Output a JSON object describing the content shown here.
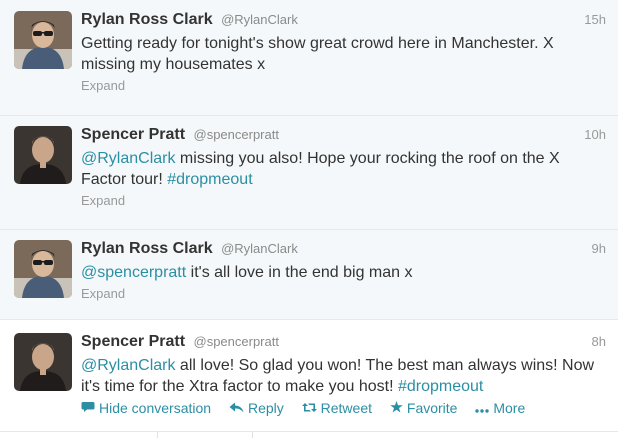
{
  "tweets": [
    {
      "fullname": "Rylan Ross Clark",
      "username": "@RylanClark",
      "time": "15h",
      "text": "Getting ready for tonight's show great crowd here in Manchester. X missing my housemates x",
      "expand": "Expand"
    },
    {
      "fullname": "Spencer Pratt",
      "username": "@spencerpratt",
      "time": "10h",
      "mention": "@RylanClark",
      "text": " missing you also! Hope your rocking the roof on the X Factor tour! ",
      "hashtag": "#dropmeout",
      "expand": "Expand"
    },
    {
      "fullname": "Rylan Ross Clark",
      "username": "@RylanClark",
      "time": "9h",
      "mention": "@spencerpratt",
      "text": " it's all love in the end big man x",
      "expand": "Expand"
    },
    {
      "fullname": "Spencer Pratt",
      "username": "@spencerpratt",
      "time": "8h",
      "mention": "@RylanClark",
      "text": " all love! So glad you won! The best man always wins! Now it's time for the Xtra factor to make you host! ",
      "hashtag": "#dropmeout",
      "actions": {
        "hide": "Hide conversation",
        "reply": "Reply",
        "retweet": "Retweet",
        "favorite": "Favorite",
        "more": "More"
      }
    }
  ],
  "colors": {
    "link": "#2b8fa4",
    "secondary_text": "#999999",
    "primary_text": "#333333"
  }
}
